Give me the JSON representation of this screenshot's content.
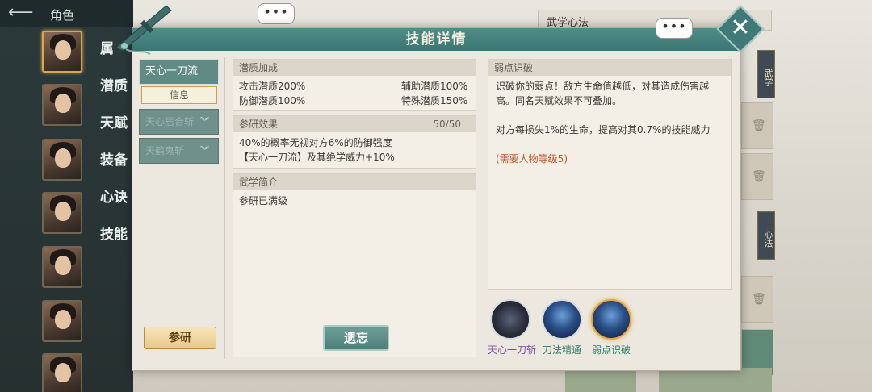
{
  "nav": {
    "back_icon": "back-arrow-icon",
    "title": "角色"
  },
  "side_menu": [
    "属",
    "潜质",
    "天赋",
    "装备",
    "心诀",
    "技能"
  ],
  "background_header": "武学心法",
  "dialog": {
    "title": "技能详情",
    "close_icon": "close-icon"
  },
  "tabs": [
    {
      "label": "天心一刀流",
      "active": true
    },
    {
      "label": "天心居合斩",
      "active": false
    },
    {
      "label": "天鹤鬼斩",
      "active": false
    }
  ],
  "info_button": "信息",
  "research_button": "参研",
  "potential": {
    "header": "潜质加成",
    "items": [
      {
        "label": "攻击潜质200%"
      },
      {
        "label": "辅助潜质100%"
      },
      {
        "label": "防御潜质100%"
      },
      {
        "label": "特殊潜质150%"
      }
    ]
  },
  "research_effect": {
    "header": "参研效果",
    "progress": "50/50",
    "lines": [
      "40%的概率无视对方6%的防御强度",
      "【天心一刀流】及其绝学威力+10%"
    ]
  },
  "intro": {
    "header": "武学简介",
    "text": "参研已满级"
  },
  "forget_button": "遗忘",
  "description": {
    "header": "弱点识破",
    "para1": "识破你的弱点！敌方生命值越低，对其造成伤害越高。同名天赋效果不可叠加。",
    "para2": "对方每损失1%的生命，提高对其0.7%的技能威力",
    "requirement": "(需要人物等级5)"
  },
  "skills": [
    {
      "label": "天心一刀斩",
      "color": "#7a4fa3",
      "icon": "blade-slash-icon"
    },
    {
      "label": "刀法精通",
      "color": "#2f7a69",
      "icon": "figure-aura-icon"
    },
    {
      "label": "弱点识破",
      "color": "#2f7a69",
      "icon": "figure-aura-icon",
      "selected": true
    }
  ],
  "colors": {
    "header_teal": "#4f8d88",
    "requirement_red": "#c0562b",
    "selected_gold": "#e2a43d"
  }
}
